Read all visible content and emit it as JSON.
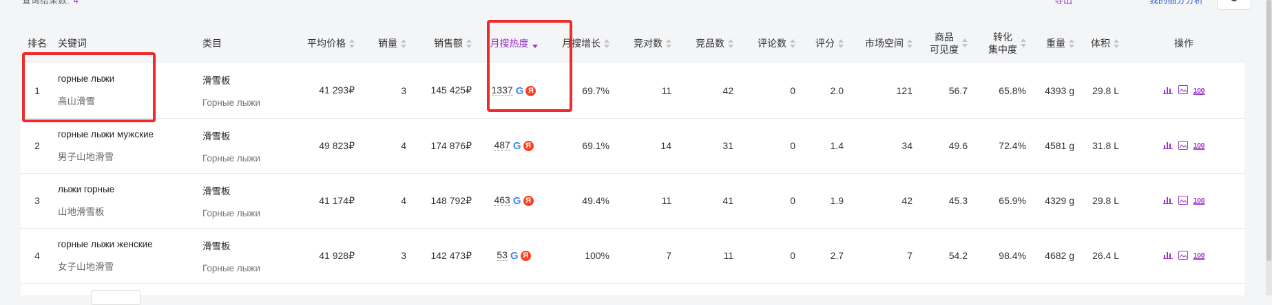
{
  "result_count": {
    "label": "查询结果数:",
    "value": "4"
  },
  "header_links": {
    "export": "导出",
    "analysis": "我的细分分析"
  },
  "columns": {
    "rank": "排名",
    "keyword": "关键词",
    "category": "类目",
    "avg_price": "平均价格",
    "sales": "销量",
    "revenue": "销售额",
    "monthly_heat": "月搜热度",
    "monthly_growth": "月搜增长",
    "competitors": "竞对数",
    "products": "竞品数",
    "reviews": "评论数",
    "rating": "评分",
    "market_space": "市场空间",
    "visibility_1": "商品",
    "visibility_2": "可见度",
    "conversion_1": "转化",
    "conversion_2": "集中度",
    "weight": "重量",
    "volume": "体积",
    "actions": "操作"
  },
  "rows": [
    {
      "rank": "1",
      "keyword": "горные лыжи",
      "keyword_cn": "高山滑雪",
      "category": "滑雪板",
      "category_ru": "Горные лыжи",
      "avg_price": "41 293₽",
      "sales": "3",
      "revenue": "145 425₽",
      "heat": "1337",
      "growth": "69.7%",
      "competitors": "11",
      "products": "42",
      "reviews": "0",
      "rating": "2.0",
      "market": "121",
      "visibility": "56.7",
      "conversion": "65.8%",
      "weight": "4393 g",
      "volume": "29.8 L"
    },
    {
      "rank": "2",
      "keyword": "горные лыжи мужские",
      "keyword_cn": "男子山地滑雪",
      "category": "滑雪板",
      "category_ru": "Горные лыжи",
      "avg_price": "49 823₽",
      "sales": "4",
      "revenue": "174 876₽",
      "heat": "487",
      "growth": "69.1%",
      "competitors": "14",
      "products": "31",
      "reviews": "0",
      "rating": "1.4",
      "market": "34",
      "visibility": "49.6",
      "conversion": "72.4%",
      "weight": "4581 g",
      "volume": "31.8 L"
    },
    {
      "rank": "3",
      "keyword": "лыжи горные",
      "keyword_cn": "山地滑雪板",
      "category": "滑雪板",
      "category_ru": "Горные лыжи",
      "avg_price": "41 174₽",
      "sales": "4",
      "revenue": "148 792₽",
      "heat": "463",
      "growth": "49.4%",
      "competitors": "11",
      "products": "41",
      "reviews": "0",
      "rating": "1.9",
      "market": "42",
      "visibility": "45.3",
      "conversion": "65.9%",
      "weight": "4329 g",
      "volume": "29.8 L"
    },
    {
      "rank": "4",
      "keyword": "горные лыжи женские",
      "keyword_cn": "女子山地滑雪",
      "category": "滑雪板",
      "category_ru": "Горные лыжи",
      "avg_price": "41 928₽",
      "sales": "3",
      "revenue": "142 473₽",
      "heat": "53",
      "growth": "100%",
      "competitors": "7",
      "products": "11",
      "reviews": "0",
      "rating": "2.7",
      "market": "7",
      "visibility": "54.2",
      "conversion": "98.4%",
      "weight": "4682 g",
      "volume": "26.4 L"
    }
  ],
  "icons": {
    "google": "G",
    "yandex": "Я",
    "chart_action": "bar-chart-icon",
    "image_action": "image-search-icon",
    "top100_action": "100"
  },
  "colors": {
    "accent": "#9b2fd1",
    "highlight": "#ee2a2a"
  }
}
